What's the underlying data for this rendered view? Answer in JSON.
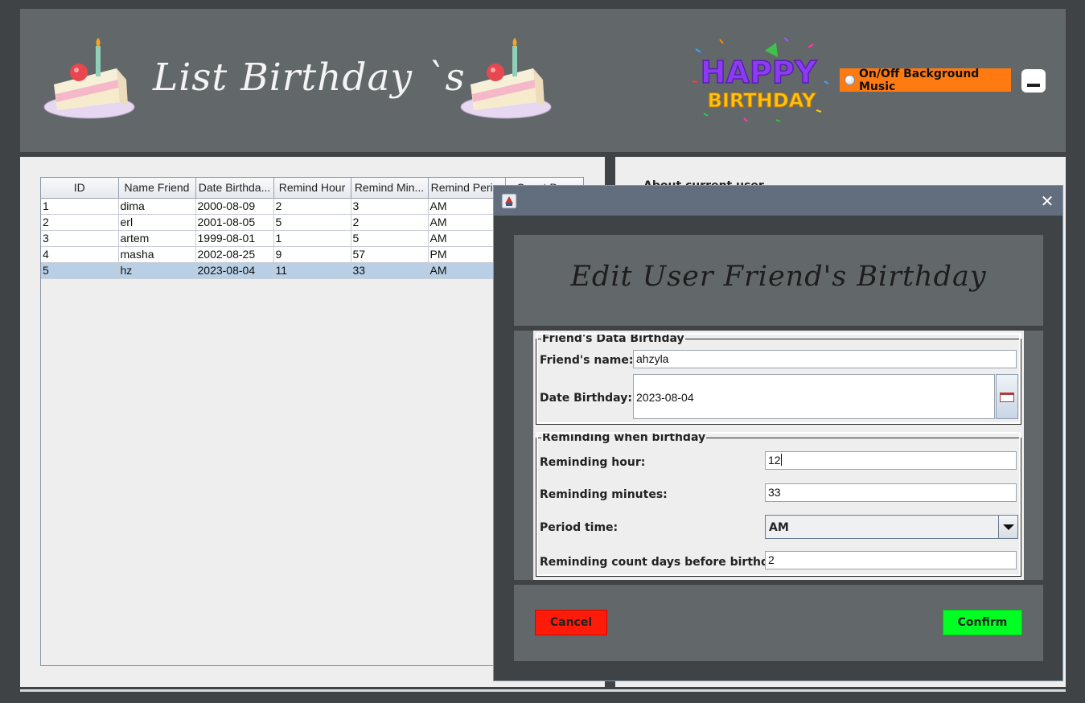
{
  "header": {
    "title": "List Birthday `s",
    "logo_text": "HAPPY BIRTHDAY",
    "music_toggle_label": "On/Off Background Music",
    "minimize_icon": "minimize-icon"
  },
  "table": {
    "columns": [
      "ID",
      "Name Friend",
      "Date Birthda...",
      "Remind Hour",
      "Remind Min...",
      "Remind Peri...",
      "Count Da..."
    ],
    "rows": [
      [
        "1",
        "dima",
        "2000-08-09",
        "2",
        "3",
        "AM"
      ],
      [
        "2",
        "erl",
        "2001-08-05",
        "5",
        "2",
        "AM"
      ],
      [
        "3",
        "artem",
        "1999-08-01",
        "1",
        "5",
        "AM"
      ],
      [
        "4",
        "masha",
        "2002-08-25",
        "9",
        "57",
        "PM"
      ],
      [
        "5",
        "hz",
        "2023-08-04",
        "11",
        "33",
        "AM"
      ]
    ],
    "selected_row": 4
  },
  "right_panel": {
    "about_label": "About current user"
  },
  "dialog": {
    "heading": "Edit User Friend's Birthday",
    "close_icon": "close-icon",
    "friend_section": {
      "legend": "Friend's Data Birthday",
      "name_label": "Friend's name:",
      "name_value": "ahzyla",
      "date_label": "Date Birthday:",
      "date_value": "2023-08-04",
      "calendar_icon": "calendar-icon"
    },
    "remind_section": {
      "legend": "Reminding when birthday",
      "hour_label": "Reminding hour:",
      "hour_value": "12",
      "minutes_label": "Reminding minutes:",
      "minutes_value": "33",
      "period_label": "Period time:",
      "period_value": "AM",
      "count_label": "Reminding count days before birthday",
      "count_value": "2"
    },
    "cancel_label": "Cancel",
    "confirm_label": "Confirm"
  },
  "colors": {
    "header_bg": "#62676a",
    "music_toggle": "#ff7a10",
    "cancel": "#ff1b0a",
    "confirm": "#00ff22",
    "selected_row": "#b8cfe5"
  }
}
